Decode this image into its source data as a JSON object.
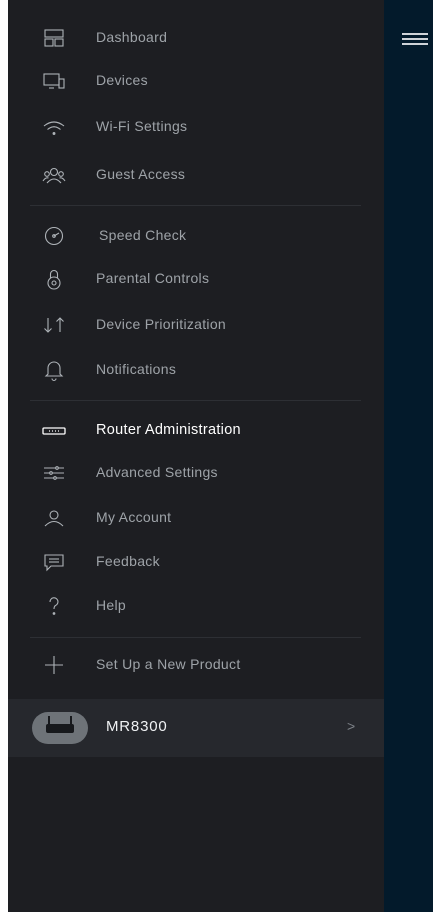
{
  "menu": {
    "sections": [
      {
        "items": [
          {
            "label": "Dashboard",
            "icon": "dashboard-icon"
          },
          {
            "label": "Devices",
            "icon": "devices-icon"
          },
          {
            "label": "Wi-Fi Settings",
            "icon": "wifi-icon"
          },
          {
            "label": "Guest Access",
            "icon": "guest-access-icon"
          }
        ]
      },
      {
        "items": [
          {
            "label": "Speed Check",
            "icon": "speedometer-icon"
          },
          {
            "label": "Parental Controls",
            "icon": "parental-controls-icon"
          },
          {
            "label": "Device Prioritization",
            "icon": "prioritization-arrows-icon"
          },
          {
            "label": "Notifications",
            "icon": "bell-icon"
          }
        ]
      },
      {
        "items": [
          {
            "label": "Router Administration",
            "icon": "router-icon",
            "active": true
          },
          {
            "label": "Advanced Settings",
            "icon": "sliders-icon"
          },
          {
            "label": "My Account",
            "icon": "user-icon"
          },
          {
            "label": "Feedback",
            "icon": "chat-bubble-icon"
          },
          {
            "label": "Help",
            "icon": "question-mark-icon"
          }
        ]
      },
      {
        "items": [
          {
            "label": "Set Up a New Product",
            "icon": "plus-icon"
          }
        ]
      }
    ]
  },
  "device": {
    "name": "MR8300",
    "chevron": ">",
    "icon": "router-thumbnail-icon"
  },
  "header": {
    "menu_icon": "hamburger-menu-icon"
  },
  "colors": {
    "menu_background": "#1d1e22",
    "right_panel_background": "#031a2b",
    "device_row_background": "#26282d",
    "label_inactive": "#9ea3a8",
    "label_active": "#ffffff"
  }
}
